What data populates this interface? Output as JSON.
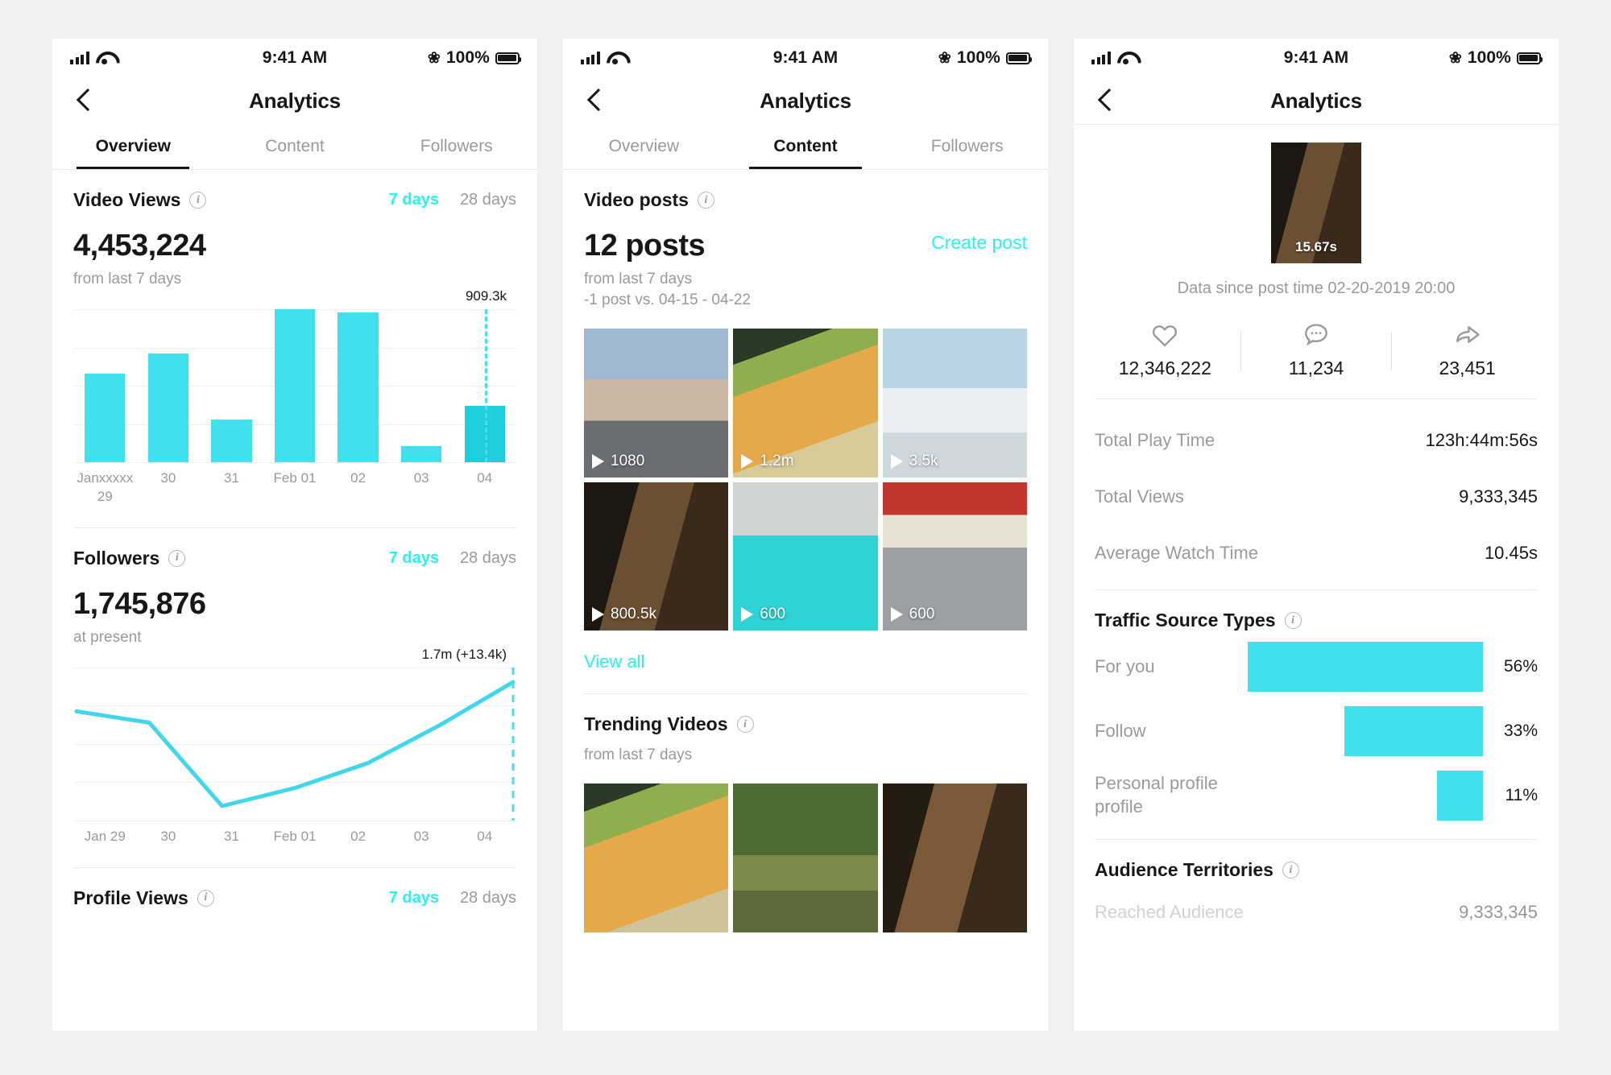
{
  "status_bar": {
    "time": "9:41 AM",
    "battery_pct": "100%"
  },
  "nav": {
    "title": "Analytics"
  },
  "panel1": {
    "tabs": [
      {
        "label": "Overview",
        "active": true
      },
      {
        "label": "Content",
        "active": false
      },
      {
        "label": "Followers",
        "active": false
      }
    ],
    "video_views": {
      "title": "Video Views",
      "range_7": "7 days",
      "range_28": "28 days",
      "value": "4,453,224",
      "meta": "from last 7 days",
      "peak_label": "909.3k"
    },
    "followers": {
      "title": "Followers",
      "range_7": "7 days",
      "range_28": "28 days",
      "value": "1,745,876",
      "meta": "at present",
      "peak_label": "1.7m (+13.4k)"
    },
    "profile_views": {
      "title": "Profile Views",
      "range_7": "7 days",
      "range_28": "28 days"
    }
  },
  "panel2": {
    "tabs": [
      {
        "label": "Overview",
        "active": false
      },
      {
        "label": "Content",
        "active": true
      },
      {
        "label": "Followers",
        "active": false
      }
    ],
    "video_posts": {
      "title": "Video posts",
      "value": "12 posts",
      "meta1": "from last 7 days",
      "meta2": "-1 post vs. 04-15 - 04-22",
      "create_post": "Create post"
    },
    "posts": [
      {
        "views": "1080",
        "art": "im1"
      },
      {
        "views": "1.2m",
        "art": "im2"
      },
      {
        "views": "3.5k",
        "art": "im3"
      },
      {
        "views": "800.5k",
        "art": "im4"
      },
      {
        "views": "600",
        "art": "im5"
      },
      {
        "views": "600",
        "art": "im6"
      }
    ],
    "view_all": "View all",
    "trending": {
      "title": "Trending Videos",
      "meta": "from last 7 days",
      "items": [
        {
          "art": "im7"
        },
        {
          "art": "im8"
        },
        {
          "art": "im9"
        }
      ]
    }
  },
  "panel3": {
    "thumb_duration": "15.67s",
    "since": "Data since post time 02-20-2019 20:00",
    "engagement": [
      {
        "icon": "heart-icon",
        "value": "12,346,222"
      },
      {
        "icon": "comment-icon",
        "value": "11,234"
      },
      {
        "icon": "share-icon",
        "value": "23,451"
      }
    ],
    "stats": [
      {
        "key": "Total Play Time",
        "value": "123h:44m:56s"
      },
      {
        "key": "Total Views",
        "value": "9,333,345"
      },
      {
        "key": "Average Watch Time",
        "value": "10.45s"
      }
    ],
    "traffic": {
      "title": "Traffic Source Types",
      "rows": [
        {
          "label": "For you",
          "pct": "56%"
        },
        {
          "label": "Follow",
          "pct": "33%"
        },
        {
          "label": "Personal profile profile",
          "pct": "11%"
        }
      ]
    },
    "territories": {
      "title": "Audience Territories",
      "row": {
        "key": "Reached Audience",
        "value": "9,333,345"
      }
    }
  },
  "chart_data": [
    {
      "type": "bar",
      "title": "Video Views",
      "categories": [
        "Janxxxxx 29",
        "30",
        "31",
        "Feb 01",
        "02",
        "03",
        "04"
      ],
      "values": [
        520,
        640,
        250,
        900,
        880,
        95,
        330
      ],
      "ylim": [
        0,
        909.3
      ],
      "peak_annotation": "909.3k",
      "highlight_index": 6,
      "grid": true,
      "xlabel": "",
      "ylabel": ""
    },
    {
      "type": "line",
      "title": "Followers",
      "x": [
        "Jan 29",
        "30",
        "31",
        "Feb 01",
        "02",
        "03",
        "04"
      ],
      "values": [
        1732,
        1727,
        1690,
        1698,
        1709,
        1726,
        1745
      ],
      "peak_annotation": "1.7m (+13.4k)",
      "grid": true,
      "xlabel": "",
      "ylabel": ""
    },
    {
      "type": "bar",
      "title": "Traffic Source Types",
      "orientation": "horizontal",
      "categories": [
        "For you",
        "Follow",
        "Personal profile profile"
      ],
      "values": [
        56,
        33,
        11
      ],
      "unit": "%",
      "ylim": [
        0,
        100
      ]
    }
  ]
}
